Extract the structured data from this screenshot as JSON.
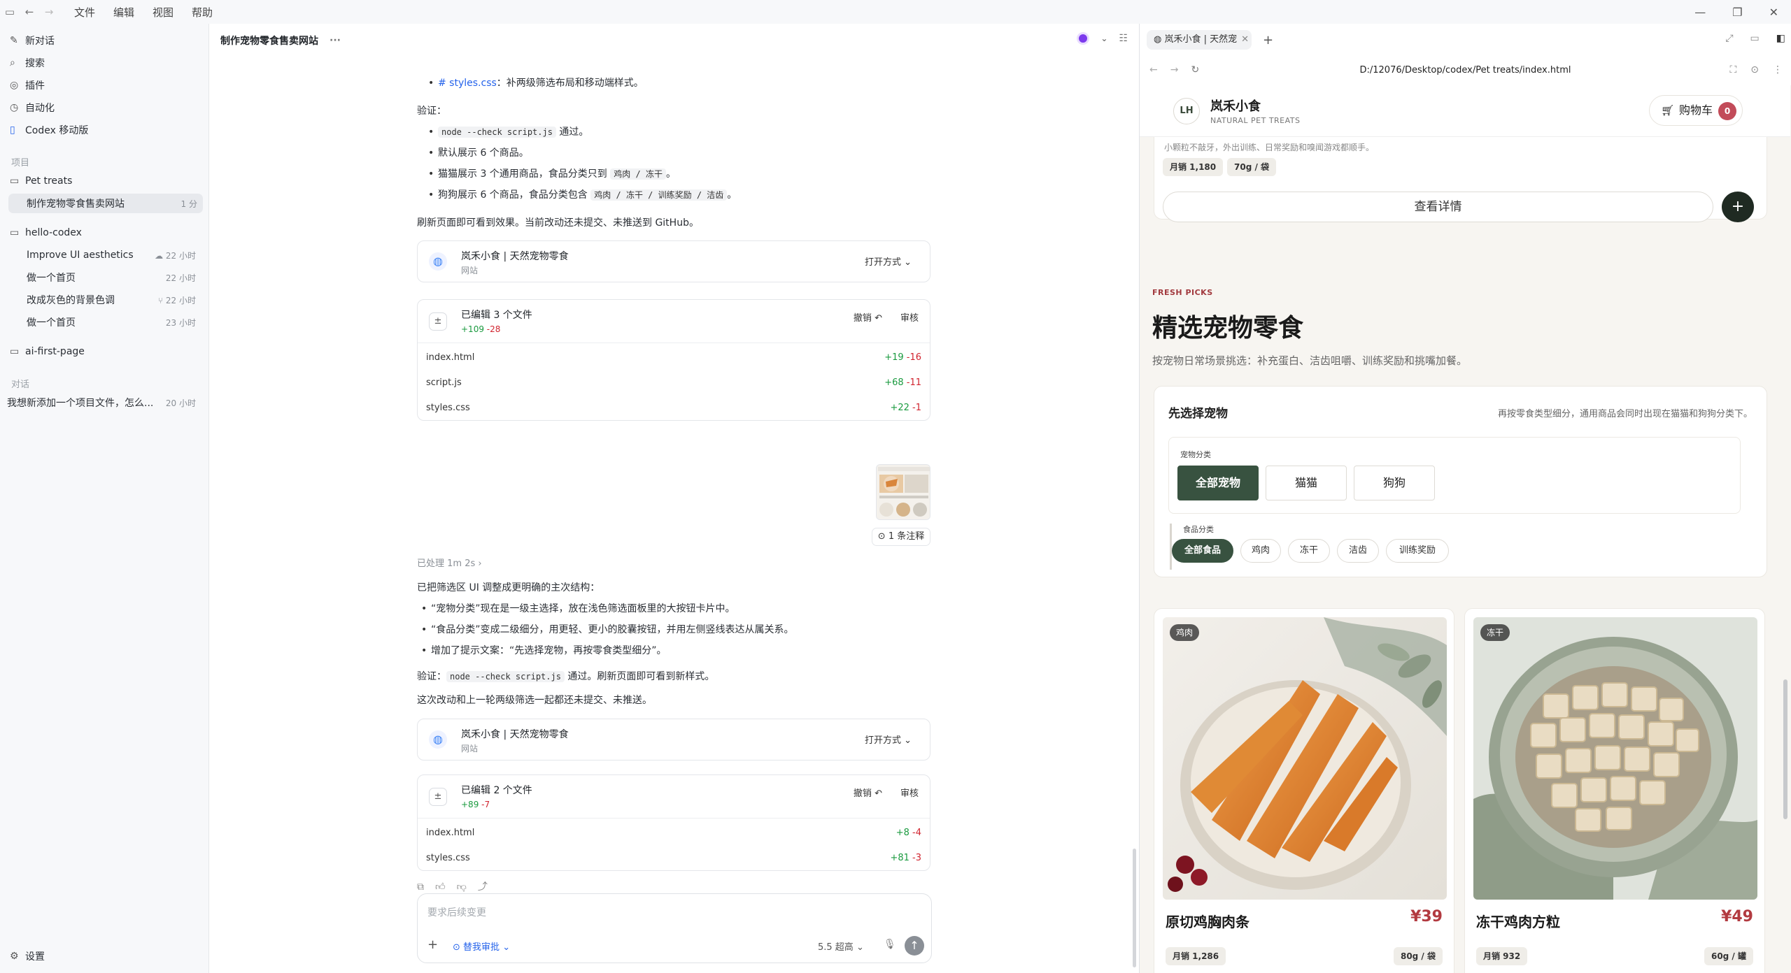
{
  "menu": [
    "文件",
    "编辑",
    "视图",
    "帮助"
  ],
  "sidebar": {
    "top": [
      {
        "icon": "new-chat-icon",
        "label": "新对话"
      },
      {
        "icon": "search-icon",
        "label": "搜索"
      },
      {
        "icon": "plugin-icon",
        "label": "插件"
      },
      {
        "icon": "automation-icon",
        "label": "自动化"
      },
      {
        "icon": "mobile-icon",
        "label": "Codex 移动版"
      }
    ],
    "projects_label": "项目",
    "projects": [
      {
        "name": "Pet treats",
        "threads": [
          {
            "title": "制作宠物零食售卖网站",
            "time": "1 分"
          }
        ]
      },
      {
        "name": "hello-codex",
        "threads": [
          {
            "title": "Improve UI aesthetics",
            "time": "22 小时"
          },
          {
            "title": "做一个首页",
            "time": "22 小时"
          },
          {
            "title": "改成灰色的背景色调",
            "time": "22 小时"
          },
          {
            "title": "做一个首页",
            "time": "23 小时"
          }
        ]
      },
      {
        "name": "ai-first-page",
        "threads": []
      }
    ],
    "chats_label": "对话",
    "chats": [
      {
        "title": "我想新添加一个项目文件，怎么...",
        "time": "20 小时"
      }
    ],
    "settings": "设置"
  },
  "chat": {
    "title": "制作宠物零食售卖网站",
    "styles_bullet": {
      "file": "# styles.css",
      "text": "：补两级筛选布局和移动端样式。"
    },
    "verify_label": "验证：",
    "verify_items": [
      {
        "code": "node --check script.js",
        "after": " 通过。"
      },
      {
        "text": "默认展示 6 个商品。"
      },
      {
        "text": "猫猫展示 3 个通用商品，食品分类只到 ",
        "code": "鸡肉 / 冻干",
        "after": "。"
      },
      {
        "text": "狗狗展示 6 个商品，食品分类包含 ",
        "code": "鸡肉 / 冻干 / 训练奖励 / 洁齿",
        "after": "。"
      }
    ],
    "refresh_note": "刷新页面即可看到效果。当前改动还未提交、未推送到 GitHub。",
    "web_card": {
      "title": "岚禾小食 | 天然宠物零食",
      "subtitle": "网站",
      "open": "打开方式"
    },
    "edit1": {
      "title": "已编辑 3 个文件",
      "add": "+109",
      "del": "-28",
      "undo": "撤销",
      "review": "审核",
      "files": [
        {
          "name": "index.html",
          "add": "+19",
          "del": "-16"
        },
        {
          "name": "script.js",
          "add": "+68",
          "del": "-11"
        },
        {
          "name": "styles.css",
          "add": "+22",
          "del": "-1"
        }
      ]
    },
    "comment_btn": "1 条注释",
    "processed": "已处理 1m 2s",
    "summary": "已把筛选区 UI 调整成更明确的主次结构：",
    "summary_items": [
      "“宠物分类”现在是一级主选择，放在浅色筛选面板里的大按钮卡片中。",
      "“食品分类”变成二级细分，用更轻、更小的胶囊按钮，并用左侧竖线表达从属关系。",
      "增加了提示文案：“先选择宠物，再按零食类型细分”。"
    ],
    "verify2": {
      "label": "验证：",
      "code": "node --check script.js",
      "after": " 通过。刷新页面即可看到新样式。"
    },
    "final_note": "这次改动和上一轮两级筛选一起都还未提交、未推送。",
    "edit2": {
      "title": "已编辑 2 个文件",
      "add": "+89",
      "del": "-7",
      "undo": "撤销",
      "review": "审核",
      "files": [
        {
          "name": "index.html",
          "add": "+8",
          "del": "-4"
        },
        {
          "name": "styles.css",
          "add": "+81",
          "del": "-3"
        }
      ]
    },
    "composer": {
      "placeholder": "要求后续变更",
      "approval": "替我审批",
      "model": "5.5 超高"
    }
  },
  "browser": {
    "tab_title": "岚禾小食 | 天然宠",
    "url": "D:/12076/Desktop/codex/Pet treats/index.html",
    "shop": {
      "logo": "LH",
      "name": "岚禾小食",
      "sub": "NATURAL PET TREATS",
      "cart": "购物车",
      "cart_count": "0",
      "prev_desc": "小颗粒不敲牙，外出训练、日常奖励和嗅闻游戏都顺手。",
      "prev_chips": [
        "月销 1,180",
        "70g / 袋"
      ],
      "detail": "查看详情",
      "eyebrow": "FRESH PICKS",
      "section_title": "精选宠物零食",
      "section_sub": "按宠物日常场景挑选：补充蛋白、洁齿咀嚼、训练奖励和挑嘴加餐。",
      "filter_title": "先选择宠物",
      "filter_hint": "再按零食类型细分，通用商品会同时出现在猫猫和狗狗分类下。",
      "pet_label": "宠物分类",
      "pets": [
        {
          "label": "全部宠物",
          "active": true
        },
        {
          "label": "猫猫",
          "active": false
        },
        {
          "label": "狗狗",
          "active": false
        }
      ],
      "food_label": "食品分类",
      "foods": [
        {
          "label": "全部食品",
          "active": true
        },
        {
          "label": "鸡肉",
          "active": false
        },
        {
          "label": "冻干",
          "active": false
        },
        {
          "label": "洁齿",
          "active": false
        },
        {
          "label": "训练奖励",
          "active": false
        }
      ],
      "products": [
        {
          "tag": "鸡肉",
          "name": "原切鸡胸肉条",
          "price": "¥39",
          "sold": "月销 1,286",
          "weight": "80g / 袋"
        },
        {
          "tag": "冻干",
          "name": "冻干鸡肉方粒",
          "price": "¥49",
          "sold": "月销 932",
          "weight": "60g / 罐"
        }
      ]
    }
  }
}
